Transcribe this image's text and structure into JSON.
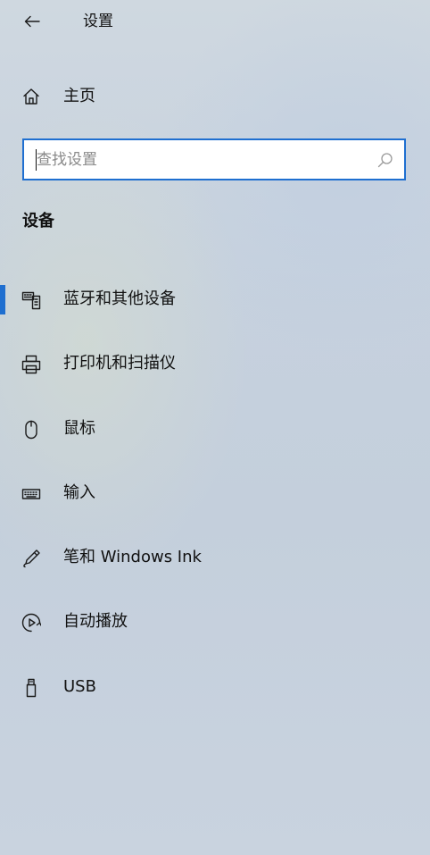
{
  "header": {
    "title": "设置"
  },
  "home": {
    "label": "主页"
  },
  "search": {
    "placeholder": "查找设置"
  },
  "section": {
    "title": "设备"
  },
  "nav": {
    "selected_index": 0,
    "items": [
      {
        "label": "蓝牙和其他设备",
        "icon": "bluetooth-devices-icon"
      },
      {
        "label": "打印机和扫描仪",
        "icon": "printer-icon"
      },
      {
        "label": "鼠标",
        "icon": "mouse-icon"
      },
      {
        "label": "输入",
        "icon": "keyboard-icon"
      },
      {
        "label": "笔和 Windows Ink",
        "icon": "pen-icon"
      },
      {
        "label": "自动播放",
        "icon": "autoplay-icon"
      },
      {
        "label": "USB",
        "icon": "usb-icon"
      }
    ]
  },
  "colors": {
    "accent": "#1f6fd0"
  }
}
